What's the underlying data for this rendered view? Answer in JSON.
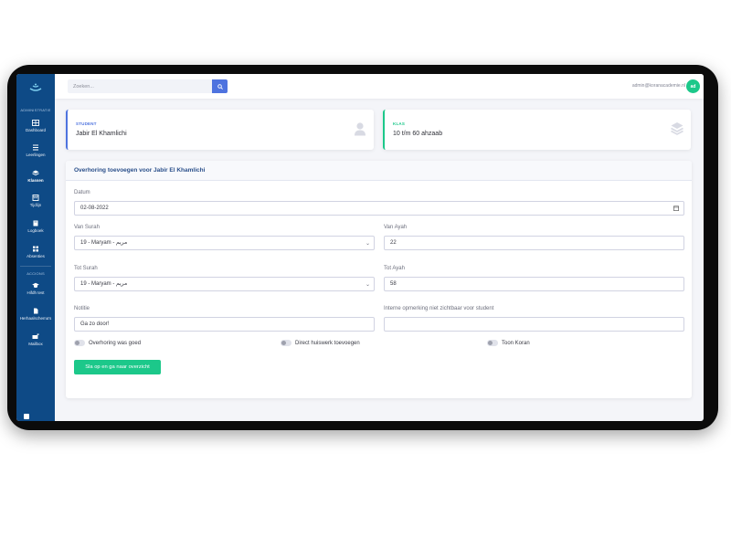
{
  "sidebar": {
    "section_admin": "ADMINISTRATIE",
    "section_acties": "ACCIONS",
    "items": [
      {
        "label": "Dashboard"
      },
      {
        "label": "Leerlingen"
      },
      {
        "label": "Klassen"
      },
      {
        "label": "Tijdlijn"
      },
      {
        "label": "Logboek"
      },
      {
        "label": "Absenties"
      },
      {
        "label": "Hifdh test"
      },
      {
        "label": "Herhaalschema's"
      },
      {
        "label": "Mailbox"
      }
    ]
  },
  "topbar": {
    "search_placeholder": "Zoeken...",
    "user_email": "admin@koranacademie.nl",
    "avatar_initials": "ad"
  },
  "student_card": {
    "label": "STUDENT",
    "value": "Jabir El Khamlichi"
  },
  "klas_card": {
    "label": "KLAS",
    "value": "10 t/m 60 ahzaab"
  },
  "form": {
    "title": "Overhoring toevoegen voor Jabir El Khamlichi",
    "datum_label": "Datum",
    "datum_value": "02-08-2022",
    "van_surah_label": "Van Surah",
    "van_surah_value": "19 - Maryam - مريم",
    "van_ayah_label": "Van Ayah",
    "van_ayah_value": "22",
    "tot_surah_label": "Tot Surah",
    "tot_surah_value": "19 - Maryam - مريم",
    "tot_ayah_label": "Tot Ayah",
    "tot_ayah_value": "58",
    "notitie_label": "Notitie",
    "notitie_value": "Ga zo door!",
    "interne_label": "Interne opmerking niet zichtbaar voor student",
    "interne_value": "",
    "toggle_goed": "Overhoring was goed",
    "toggle_huiswerk": "Direct huiswerk toevoegen",
    "toggle_koran": "Toon Koran",
    "submit_label": "Sla op en ga naar overzicht"
  },
  "colors": {
    "sidebar": "#0e4a86",
    "primary": "#4e73df",
    "success": "#1cc88a"
  }
}
